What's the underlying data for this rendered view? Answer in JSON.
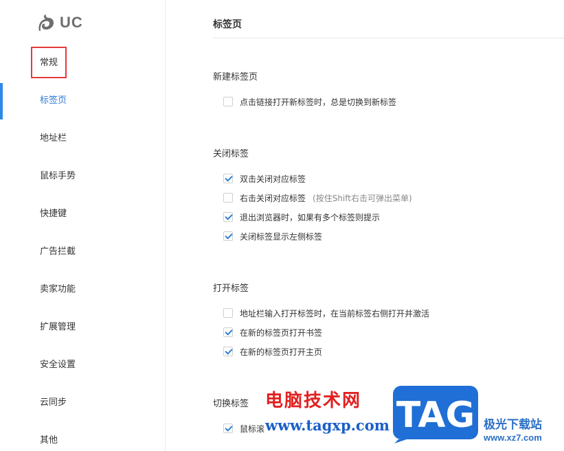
{
  "sidebar": {
    "logo_text": "UC",
    "items": [
      {
        "label": "常规"
      },
      {
        "label": "标签页"
      },
      {
        "label": "地址栏"
      },
      {
        "label": "鼠标手势"
      },
      {
        "label": "快捷键"
      },
      {
        "label": "广告拦截"
      },
      {
        "label": "卖家功能"
      },
      {
        "label": "扩展管理"
      },
      {
        "label": "安全设置"
      },
      {
        "label": "云同步"
      },
      {
        "label": "其他"
      }
    ],
    "active_index": 1
  },
  "main": {
    "title": "标签页",
    "sections": [
      {
        "title": "新建标签页",
        "options": [
          {
            "label": "点击链接打开新标签时，总是切换到新标签",
            "checked": false
          }
        ]
      },
      {
        "title": "关闭标签",
        "options": [
          {
            "label": "双击关闭对应标签",
            "checked": true
          },
          {
            "label": "右击关闭对应标签",
            "hint": "(按住Shift右击可弹出菜单)",
            "checked": false
          },
          {
            "label": "退出浏览器时，如果有多个标签则提示",
            "checked": true
          },
          {
            "label": "关闭标签显示左侧标签",
            "checked": true
          }
        ]
      },
      {
        "title": "打开标签",
        "options": [
          {
            "label": "地址栏输入打开标签时，在当前标签右侧打开并激活",
            "checked": false
          },
          {
            "label": "在新的标签页打开书签",
            "checked": true
          },
          {
            "label": "在新的标签页打开主页",
            "checked": true
          }
        ]
      },
      {
        "title": "切换标签",
        "options": [
          {
            "label": "鼠标滚",
            "checked": true
          }
        ]
      }
    ]
  },
  "watermark": {
    "cn_text": "电脑技术网",
    "url": "www.tagxp.com",
    "tag": "TAG",
    "site_name": "极光下载站",
    "site_domain": "www.xz7.com"
  },
  "colors": {
    "accent": "#2c7cd6",
    "active_bar": "#2e88e8",
    "highlight_border": "#e23b3b",
    "check": "#2e7fd4",
    "watermark_red": "#e02020",
    "watermark_blue": "#1a5fc8"
  }
}
